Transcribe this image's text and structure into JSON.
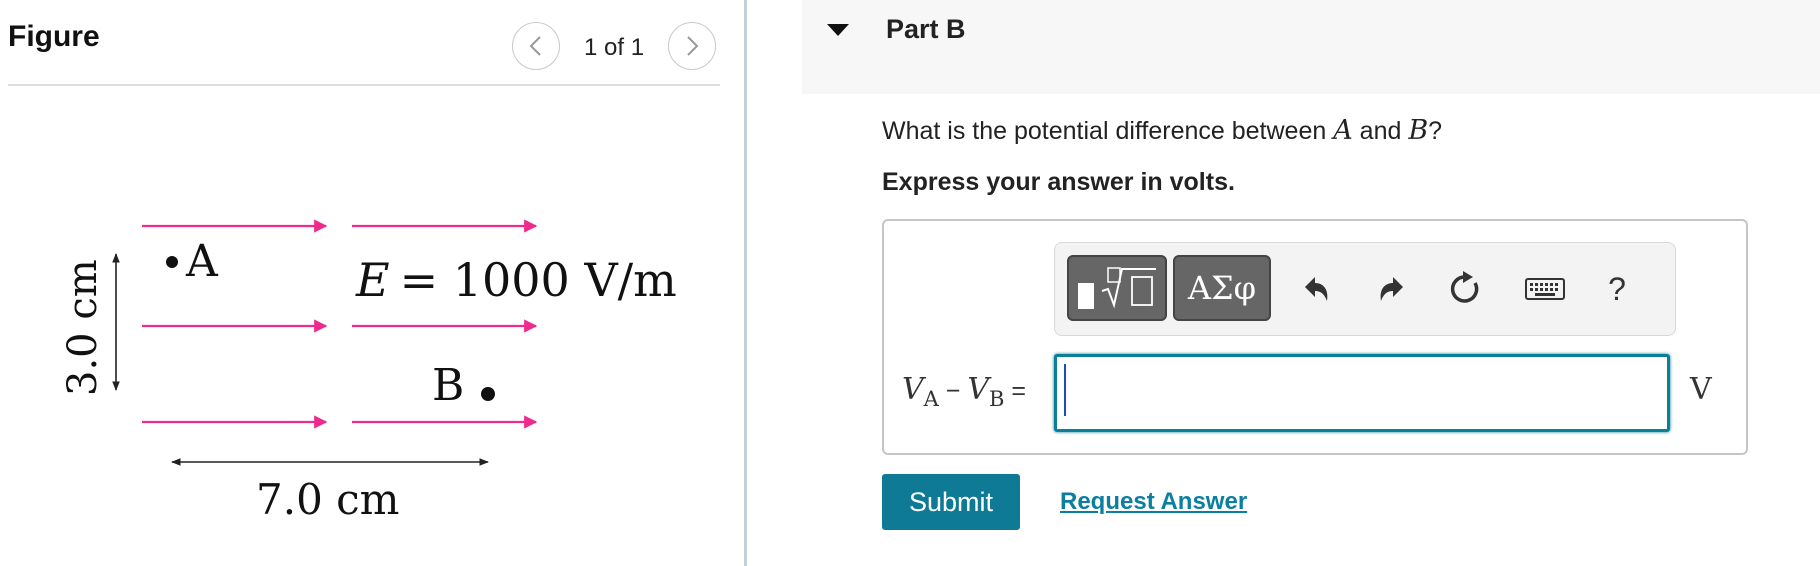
{
  "figure_panel": {
    "title": "Figure",
    "page_indicator": "1 of 1",
    "prev_icon": "chevron-left-icon",
    "next_icon": "chevron-right-icon",
    "diagram": {
      "point_a_label": "A",
      "point_b_label": "B",
      "field_var": "E",
      "field_value": "= 1000 V/m",
      "height_label": "3.0 cm",
      "width_label": "7.0 cm",
      "arrow_color": "#ee2a8a"
    }
  },
  "part": {
    "title": "Part B",
    "collapse_icon": "caret-down-icon"
  },
  "question": {
    "text_before": "What is the potential difference between ",
    "var_a": "A",
    "text_and": " and ",
    "var_b": "B",
    "text_end": "?",
    "instruction": "Express your answer in volts."
  },
  "toolbar": {
    "templates_icon": "templates-sqrt-icon",
    "symbols_label": "ΑΣφ",
    "undo_icon": "undo-icon",
    "redo_icon": "redo-icon",
    "reset_icon": "reset-icon",
    "keyboard_icon": "keyboard-icon",
    "help_label": "?"
  },
  "answer": {
    "var_v": "V",
    "sub_a": "A",
    "minus": " − ",
    "sub_b": "B",
    "equals": " =",
    "value": "",
    "unit": "V"
  },
  "actions": {
    "submit_label": "Submit",
    "request_answer_label": "Request Answer"
  },
  "colors": {
    "accent": "#0e7a96",
    "link": "#0c7ea0",
    "field_arrows": "#ee2a8a"
  }
}
